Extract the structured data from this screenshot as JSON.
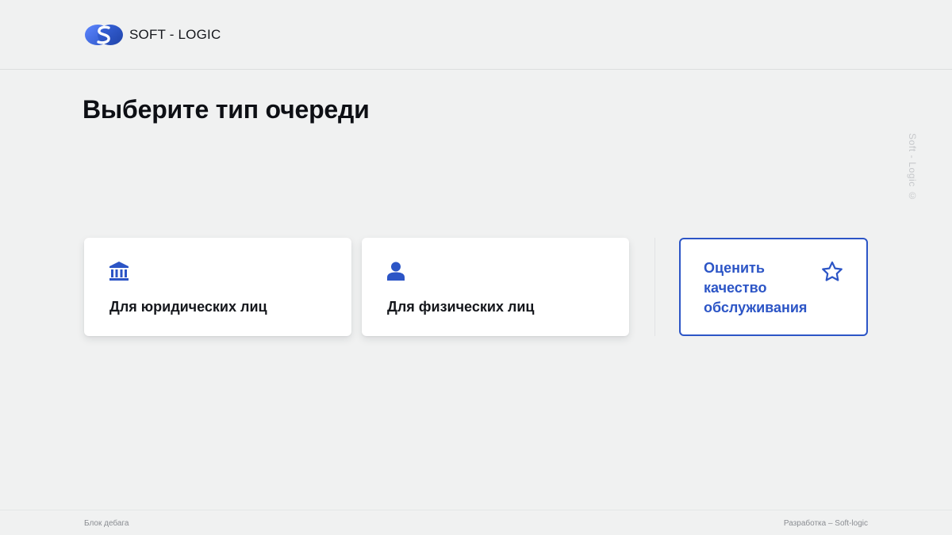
{
  "header": {
    "logo_text": "SOFT - LOGIC",
    "logo_icon": "softlogic-s-logo"
  },
  "main": {
    "title": "Выберите тип очереди",
    "cards": [
      {
        "label": "Для юридических лиц",
        "icon": "bank-icon"
      },
      {
        "label": "Для физических лиц",
        "icon": "person-icon"
      }
    ],
    "rate": {
      "label": "Оценить качество обслуживания",
      "icon": "star-icon"
    }
  },
  "side_watermark": "Soft - Logic ©",
  "footer": {
    "left": "Блок дебага",
    "right": "Разработка – Soft-logic"
  },
  "colors": {
    "accent": "#2c55c6",
    "background": "#f0f1f1",
    "card": "#ffffff"
  }
}
